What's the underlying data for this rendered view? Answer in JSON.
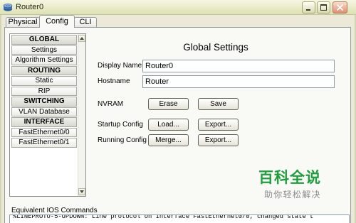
{
  "window": {
    "title": "Router0",
    "icon": "router-icon",
    "controls": [
      "minimize-icon",
      "maximize-icon",
      "close-icon"
    ]
  },
  "tabs": [
    {
      "label": "Physical"
    },
    {
      "label": "Config",
      "selected": true
    },
    {
      "label": "CLI"
    }
  ],
  "sidebar": {
    "sections": [
      {
        "header": "GLOBAL",
        "items": [
          "Settings",
          "Algorithm Settings"
        ]
      },
      {
        "header": "ROUTING",
        "items": [
          "Static",
          "RIP"
        ]
      },
      {
        "header": "SWITCHING",
        "items": [
          "VLAN Database"
        ]
      },
      {
        "header": "INTERFACE",
        "items": [
          "FastEthernet0/0",
          "FastEthernet0/1"
        ]
      }
    ]
  },
  "settings": {
    "heading": "Global Settings",
    "display_name": {
      "label": "Display Name",
      "value": "Router0"
    },
    "hostname": {
      "label": "Hostname",
      "value": "Router"
    },
    "nvram": {
      "label": "NVRAM",
      "erase": "Erase",
      "save": "Save"
    },
    "startup_config": {
      "label": "Startup Config",
      "load": "Load...",
      "export": "Export..."
    },
    "running_config": {
      "label": "Running Config",
      "merge": "Merge...",
      "export": "Export..."
    }
  },
  "ios_commands": {
    "label": "Equivalent IOS Commands",
    "output": "%LINEPROTO-5-UPDOWN: Line protocol on Interface FastEthernet0/0, changed state t"
  },
  "watermark": {
    "brand": "百科全说",
    "tagline": "助你轻松解决"
  },
  "colors": {
    "title_bar_top": "#f6f7e2",
    "title_bar_bottom": "#dde1b2",
    "window_bg": "#ece9d8",
    "panel_bg": "#f9f9f6",
    "watermark_brand": "#1f9e3e",
    "watermark_tagline": "#8c8c8c"
  }
}
